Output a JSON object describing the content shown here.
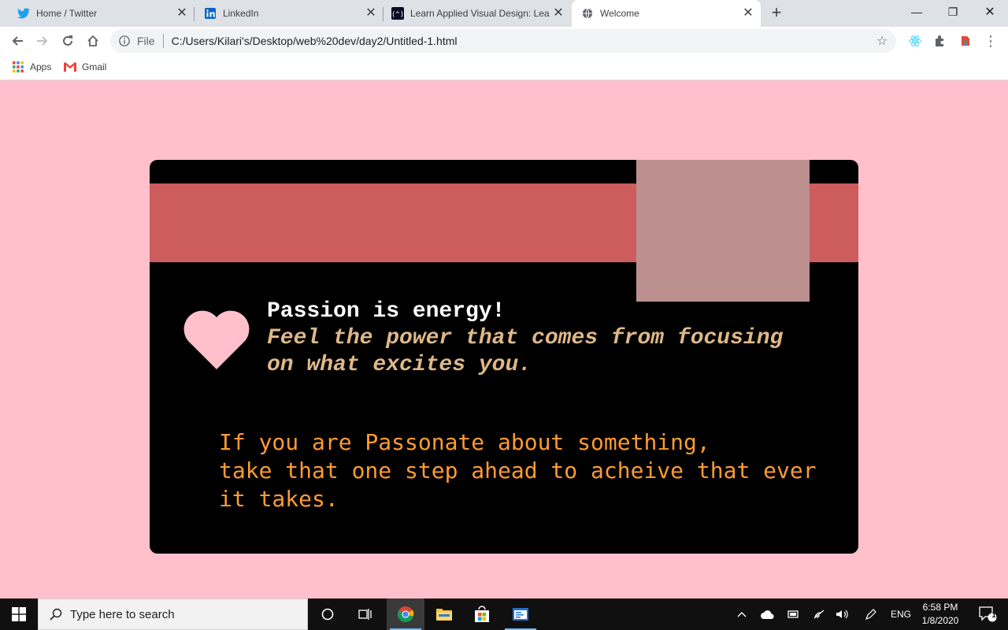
{
  "browser": {
    "tabs": [
      {
        "title": "Home / Twitter",
        "icon": "twitter-icon"
      },
      {
        "title": "LinkedIn",
        "icon": "linkedin-icon"
      },
      {
        "title": "Learn Applied Visual Design: Lea",
        "icon": "freecodecamp-icon"
      },
      {
        "title": "Welcome",
        "icon": "globe-icon",
        "active": true
      }
    ],
    "new_tab_label": "+",
    "window_controls": {
      "minimize": "—",
      "restore": "❐",
      "close": "✕"
    },
    "address": {
      "scheme_label": "File",
      "url": "C:/Users/Kilari's/Desktop/web%20dev/day2/Untitled-1.html"
    },
    "bookmarks": [
      {
        "label": "Apps",
        "icon": "apps-grid-icon"
      },
      {
        "label": "Gmail",
        "icon": "gmail-icon"
      }
    ]
  },
  "page": {
    "background": "#ffc0cb",
    "card": {
      "background": "#000000",
      "band_color": "#cd5c5c",
      "square_color": "#bc8f8f",
      "heart_color": "#ffc0cb",
      "heading": "Passion is energy!",
      "subheading_line1": "Feel the power that comes from focusing",
      "subheading_line2": "on what excites you.",
      "body_line1": "If you are Passonate about something,",
      "body_line2": "take that one step ahead to acheive that ever",
      "body_line3": "it takes."
    }
  },
  "taskbar": {
    "search_placeholder": "Type here to search",
    "language": "ENG",
    "time": "6:58 PM",
    "date": "1/8/2020",
    "notification_count": "1"
  }
}
